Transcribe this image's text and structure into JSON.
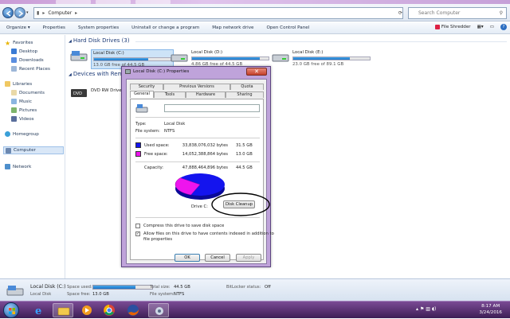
{
  "window": {
    "address": "Computer",
    "search_placeholder": "Search Computer"
  },
  "toolbar": {
    "items": [
      "Organize ▾",
      "Properties",
      "System properties",
      "Uninstall or change a program",
      "Map network drive",
      "Open Control Panel"
    ],
    "file_shredder": "File Shredder"
  },
  "sidebar": {
    "favorites": "Favorites",
    "desktop": "Desktop",
    "downloads": "Downloads",
    "recent": "Recent Places",
    "libraries": "Libraries",
    "documents": "Documents",
    "music": "Music",
    "pictures": "Pictures",
    "videos": "Videos",
    "homegroup": "Homegroup",
    "computer": "Computer",
    "network": "Network"
  },
  "content": {
    "hdd_group": "Hard Disk Drives (3)",
    "removable_group": "Devices with Remo",
    "dvd_label": "DVD RW Drive",
    "drives": [
      {
        "name": "Local Disk (C:)",
        "free": "13.0 GB free of 44.5 GB",
        "used_fraction": 0.71
      },
      {
        "name": "Local Disk (D:)",
        "free": "4.86 GB free of 44.5 GB",
        "used_fraction": 0.89
      },
      {
        "name": "Local Disk (E:)",
        "free": "23.0 GB free of 89.1 GB",
        "used_fraction": 0.74
      }
    ]
  },
  "dialog": {
    "title": "Local Disk (C:) Properties",
    "close": "✕",
    "tabs_top": [
      "Security",
      "Previous Versions",
      "Quota"
    ],
    "tabs_bottom": [
      "General",
      "Tools",
      "Hardware",
      "Sharing"
    ],
    "type_label": "Type:",
    "type_value": "Local Disk",
    "fs_label": "File system:",
    "fs_value": "NTFS",
    "used_label": "Used space:",
    "used_bytes": "33,838,076,032 bytes",
    "used_gb": "31.5 GB",
    "free_label": "Free space:",
    "free_bytes": "14,052,388,864 bytes",
    "free_gb": "13.0 GB",
    "cap_label": "Capacity:",
    "cap_bytes": "47,888,464,896 bytes",
    "cap_gb": "44.5 GB",
    "drive_label": "Drive C:",
    "cleanup": "Disk Cleanup",
    "compress": "Compress this drive to save disk space",
    "index_line1": "Allow files on this drive to have contents indexed in addition to",
    "index_line2": "file properties",
    "ok": "OK",
    "cancel": "Cancel",
    "apply": "Apply",
    "used_color": "#1414ee",
    "free_color": "#ee14ee",
    "used_fraction": 0.707
  },
  "details": {
    "name": "Local Disk (C:)",
    "kind": "Local Disk",
    "space_used_label": "Space used:",
    "space_free_label": "Space free:",
    "space_free": "13.0 GB",
    "total_label": "Total size:",
    "total": "44.5 GB",
    "fs_label": "File system:",
    "fs": "NTFS",
    "bitlocker_label": "BitLocker status:",
    "bitlocker": "Off",
    "used_fraction": 0.71
  },
  "taskbar": {
    "time": "8:17 AM",
    "date": "3/24/2016"
  }
}
